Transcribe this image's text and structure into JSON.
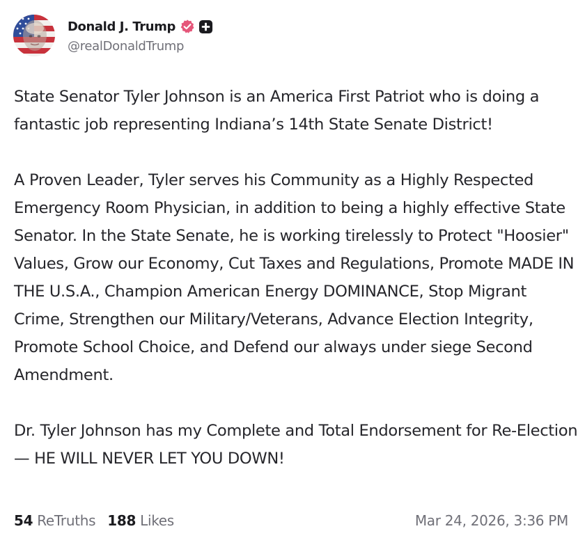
{
  "author": {
    "display_name": "Donald J. Trump",
    "handle": "@realDonaldTrump"
  },
  "icons": {
    "verified": "verified-badge-icon",
    "plus": "plus-badge-icon"
  },
  "colors": {
    "verified": "#e5567a",
    "text": "#26262b",
    "muted": "#707078"
  },
  "post": {
    "paragraphs": [
      "State Senator Tyler Johnson is an America First Patriot who is doing a fantastic job representing Indiana’s 14th State Senate District!",
      "A Proven Leader, Tyler serves his Community as a Highly Respected Emergency Room Physician, in addition to being a highly effective State Senator. In the State Senate, he is working tirelessly to Protect \"Hoosier\" Values, Grow our Economy, Cut Taxes and Regulations, Promote MADE IN THE U.S.A., Champion American Energy DOMINANCE, Stop Migrant Crime, Strengthen our Military/Veterans, Advance Election Integrity, Promote School Choice, and Defend our always under siege Second Amendment.",
      "Dr. Tyler Johnson has my Complete and Total Endorsement for Re-Election — HE WILL NEVER LET YOU DOWN!"
    ]
  },
  "stats": {
    "retruths_count": "54",
    "retruths_label": "ReTruths",
    "likes_count": "188",
    "likes_label": "Likes"
  },
  "timestamp": "Mar 24, 2026, 3:36 PM"
}
